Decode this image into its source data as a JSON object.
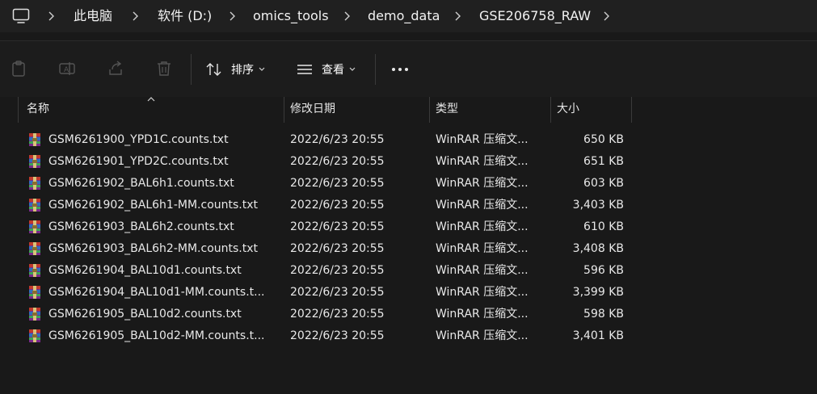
{
  "breadcrumb": {
    "items": [
      "此电脑",
      "软件 (D:)",
      "omics_tools",
      "demo_data",
      "GSE206758_RAW"
    ]
  },
  "toolbar": {
    "sort_label": "排序",
    "view_label": "查看"
  },
  "columns": [
    "名称",
    "修改日期",
    "类型",
    "大小"
  ],
  "files": [
    {
      "name": "GSM6261900_YPD1C.counts.txt",
      "date": "2022/6/23 20:55",
      "type": "WinRAR 压缩文...",
      "size": "650 KB"
    },
    {
      "name": "GSM6261901_YPD2C.counts.txt",
      "date": "2022/6/23 20:55",
      "type": "WinRAR 压缩文...",
      "size": "651 KB"
    },
    {
      "name": "GSM6261902_BAL6h1.counts.txt",
      "date": "2022/6/23 20:55",
      "type": "WinRAR 压缩文...",
      "size": "603 KB"
    },
    {
      "name": "GSM6261902_BAL6h1-MM.counts.txt",
      "date": "2022/6/23 20:55",
      "type": "WinRAR 压缩文...",
      "size": "3,403 KB"
    },
    {
      "name": "GSM6261903_BAL6h2.counts.txt",
      "date": "2022/6/23 20:55",
      "type": "WinRAR 压缩文...",
      "size": "610 KB"
    },
    {
      "name": "GSM6261903_BAL6h2-MM.counts.txt",
      "date": "2022/6/23 20:55",
      "type": "WinRAR 压缩文...",
      "size": "3,408 KB"
    },
    {
      "name": "GSM6261904_BAL10d1.counts.txt",
      "date": "2022/6/23 20:55",
      "type": "WinRAR 压缩文...",
      "size": "596 KB"
    },
    {
      "name": "GSM6261904_BAL10d1-MM.counts.t...",
      "date": "2022/6/23 20:55",
      "type": "WinRAR 压缩文...",
      "size": "3,399 KB"
    },
    {
      "name": "GSM6261905_BAL10d2.counts.txt",
      "date": "2022/6/23 20:55",
      "type": "WinRAR 压缩文...",
      "size": "598 KB"
    },
    {
      "name": "GSM6261905_BAL10d2-MM.counts.t...",
      "date": "2022/6/23 20:55",
      "type": "WinRAR 压缩文...",
      "size": "3,401 KB"
    }
  ]
}
